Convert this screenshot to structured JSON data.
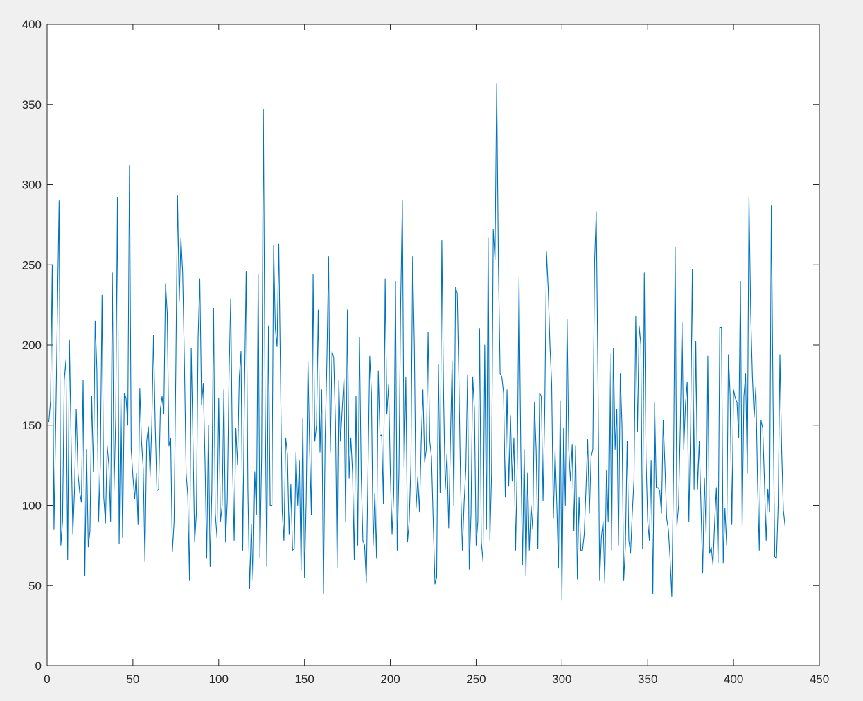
{
  "chart_data": {
    "type": "line",
    "title": "",
    "xlabel": "",
    "ylabel": "",
    "xlim": [
      0,
      450
    ],
    "ylim": [
      0,
      400
    ],
    "xticks": [
      0,
      50,
      100,
      150,
      200,
      250,
      300,
      350,
      400,
      450
    ],
    "yticks": [
      0,
      50,
      100,
      150,
      200,
      250,
      300,
      350,
      400
    ],
    "xtick_labels": [
      "0",
      "50",
      "100",
      "150",
      "200",
      "250",
      "300",
      "350",
      "400",
      "450"
    ],
    "ytick_labels": [
      "0",
      "50",
      "100",
      "150",
      "200",
      "250",
      "300",
      "350",
      "400"
    ],
    "grid": false,
    "box": true,
    "colors": {
      "line": "#0072bd",
      "axes": "#262626",
      "plot_bg": "#ffffff",
      "figure_bg": "#f0f0f0"
    },
    "series": [
      {
        "x_start": 1,
        "x_step": 1,
        "values": [
          152,
          165,
          250,
          85,
          150,
          220,
          290,
          75,
          90,
          178,
          191,
          66,
          203,
          140,
          82,
          110,
          160,
          120,
          108,
          102,
          178,
          56,
          135,
          74,
          84,
          168,
          121,
          215,
          185,
          90,
          125,
          231,
          105,
          89,
          137,
          125,
          90,
          245,
          110,
          155,
          292,
          76,
          168,
          80,
          170,
          167,
          150,
          312,
          135,
          118,
          104,
          120,
          88,
          173,
          140,
          123,
          65,
          140,
          149,
          118,
          150,
          206,
          150,
          109,
          110,
          160,
          168,
          157,
          238,
          220,
          137,
          142,
          71,
          90,
          185,
          293,
          227,
          267,
          245,
          190,
          120,
          106,
          53,
          198,
          140,
          77,
          95,
          205,
          241,
          163,
          176,
          128,
          67,
          150,
          62,
          110,
          223,
          95,
          80,
          167,
          90,
          100,
          172,
          77,
          103,
          180,
          229,
          130,
          78,
          148,
          125,
          180,
          196,
          72,
          170,
          246,
          110,
          48,
          88,
          53,
          121,
          94,
          244,
          67,
          130,
          347,
          168,
          62,
          212,
          100,
          100,
          262,
          210,
          199,
          263,
          180,
          96,
          78,
          142,
          132,
          82,
          113,
          72,
          73,
          133,
          100,
          128,
          59,
          154,
          55,
          103,
          190,
          135,
          94,
          244,
          140,
          150,
          222,
          133,
          172,
          45,
          142,
          190,
          255,
          133,
          196,
          192,
          152,
          61,
          178,
          140,
          160,
          179,
          90,
          222,
          117,
          142,
          120,
          66,
          168,
          75,
          205,
          120,
          78,
          75,
          52,
          120,
          193,
          170,
          75,
          108,
          67,
          184,
          143,
          144,
          101,
          241,
          157,
          175,
          120,
          82,
          108,
          240,
          72,
          120,
          225,
          290,
          124,
          180,
          77,
          90,
          125,
          255,
          200,
          98,
          118,
          96,
          140,
          172,
          127,
          135,
          208,
          140,
          130,
          90,
          51,
          55,
          188,
          108,
          265,
          170,
          110,
          132,
          86,
          140,
          190,
          100,
          236,
          232,
          175,
          110,
          72,
          102,
          123,
          181,
          60,
          94,
          180,
          160,
          75,
          90,
          210,
          77,
          65,
          200,
          85,
          267,
          78,
          120,
          272,
          253,
          363,
          250,
          182,
          180,
          170,
          105,
          172,
          112,
          156,
          115,
          142,
          72,
          130,
          242,
          135,
          63,
          135,
          56,
          120,
          72,
          100,
          85,
          164,
          134,
          73,
          170,
          168,
          103,
          160,
          258,
          235,
          200,
          176,
          92,
          134,
          100,
          61,
          165,
          41,
          148,
          100,
          216,
          135,
          115,
          138,
          84,
          137,
          54,
          105,
          72,
          72,
          82,
          110,
          141,
          95,
          130,
          135,
          252,
          283,
          180,
          53,
          80,
          90,
          52,
          122,
          90,
          195,
          72,
          198,
          135,
          160,
          75,
          182,
          150,
          53,
          75,
          140,
          78,
          70,
          95,
          116,
          218,
          146,
          212,
          200,
          73,
          245,
          130,
          90,
          78,
          128,
          45,
          164,
          111,
          111,
          109,
          95,
          153,
          125,
          92,
          85,
          67,
          43,
          120,
          261,
          87,
          100,
          150,
          214,
          135,
          163,
          177,
          90,
          150,
          247,
          110,
          202,
          110,
          140,
          100,
          58,
          117,
          82,
          193,
          70,
          74,
          63,
          90,
          111,
          64,
          211,
          211,
          64,
          98,
          75,
          194,
          169,
          88,
          172,
          167,
          164,
          142,
          240,
          87,
          168,
          182,
          120,
          292,
          220,
          180,
          155,
          174,
          115,
          72,
          153,
          148,
          115,
          78,
          110,
          96,
          287,
          165,
          68,
          67,
          100,
          194,
          135,
          97,
          87
        ]
      }
    ]
  }
}
